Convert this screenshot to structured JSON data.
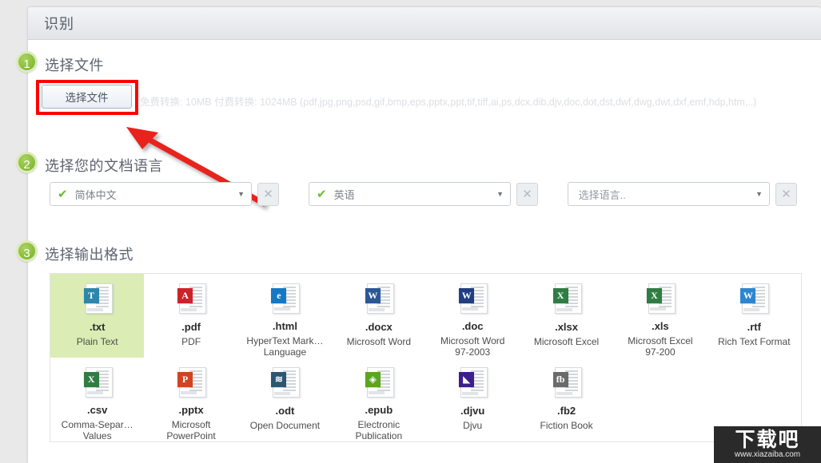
{
  "panel": {
    "title": "识别"
  },
  "steps": [
    {
      "number": "1",
      "title": "选择文件"
    },
    {
      "number": "2",
      "title": "选择您的文档语言"
    },
    {
      "number": "3",
      "title": "选择输出格式"
    }
  ],
  "file_step": {
    "button_label": "选择文件",
    "hint": "免费转换: 10MB  付费转换: 1024MB    (pdf,jpg,png,psd,gif,bmp,eps,pptx,ppt,tif,tiff,ai,ps,dcx,dib,djv,doc,dot,dst,dwf,dwg,dwt,dxf,emf,hdp,htm,..)"
  },
  "languages": [
    {
      "value": "简体中文",
      "checked": true,
      "clear_label": "✕"
    },
    {
      "value": "英语",
      "checked": true,
      "clear_label": "✕"
    },
    {
      "value": "选择语言..",
      "checked": false,
      "clear_label": "✕"
    }
  ],
  "formats": [
    {
      "ext": ".txt",
      "desc": "Plain Text",
      "badge": "T",
      "color": "#2e86ab",
      "selected": true
    },
    {
      "ext": ".pdf",
      "desc": "PDF",
      "badge": "A",
      "color": "#cc2229",
      "selected": false
    },
    {
      "ext": ".html",
      "desc": "HyperText Mark… Language",
      "badge": "e",
      "color": "#1479c4",
      "selected": false
    },
    {
      "ext": ".docx",
      "desc": "Microsoft Word",
      "badge": "W",
      "color": "#2b5797",
      "selected": false
    },
    {
      "ext": ".doc",
      "desc": "Microsoft Word 97-2003",
      "badge": "W",
      "color": "#1f3f82",
      "selected": false
    },
    {
      "ext": ".xlsx",
      "desc": "Microsoft Excel",
      "badge": "X",
      "color": "#2f7d43",
      "selected": false
    },
    {
      "ext": ".xls",
      "desc": "Microsoft Excel 97-200",
      "badge": "X",
      "color": "#2f7d43",
      "selected": false
    },
    {
      "ext": ".rtf",
      "desc": "Rich Text Format",
      "badge": "W",
      "color": "#2f86d0",
      "selected": false
    },
    {
      "ext": ".csv",
      "desc": "Comma-Separ… Values",
      "badge": "X",
      "color": "#2f7d43",
      "selected": false
    },
    {
      "ext": ".pptx",
      "desc": "Microsoft PowerPoint",
      "badge": "P",
      "color": "#d04423",
      "selected": false
    },
    {
      "ext": ".odt",
      "desc": "Open Document",
      "badge": "≋",
      "color": "#2c5773",
      "selected": false
    },
    {
      "ext": ".epub",
      "desc": "Electronic Publication",
      "badge": "◈",
      "color": "#5aa521",
      "selected": false
    },
    {
      "ext": ".djvu",
      "desc": "Djvu",
      "badge": "◣",
      "color": "#3b1f8f",
      "selected": false
    },
    {
      "ext": ".fb2",
      "desc": "Fiction Book",
      "badge": "fb",
      "color": "#6b6b6b",
      "selected": false
    }
  ],
  "watermark": {
    "brand": "下载吧",
    "url": "www.xiazaiba.com"
  },
  "colors": {
    "accent_green": "#8cbf3f",
    "selected_bg": "#dbedb4",
    "annotation_red": "#fe0000"
  }
}
